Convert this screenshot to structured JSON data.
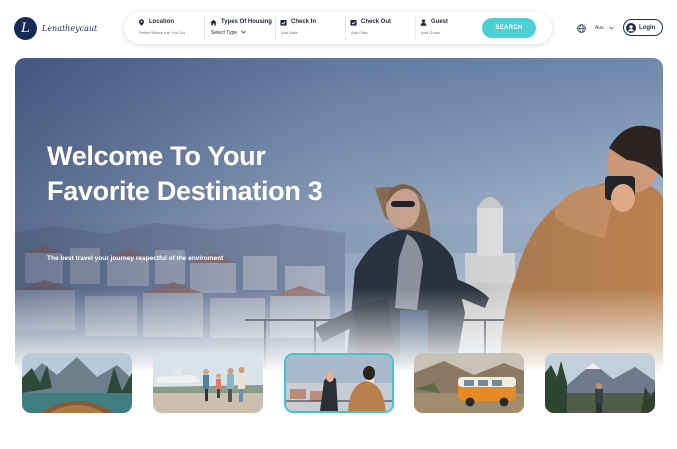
{
  "brand": {
    "name": "Lenatheycaut",
    "initial": "L"
  },
  "search": {
    "location": {
      "label": "Location",
      "placeholder": "Select Where Are You Goi..."
    },
    "housing": {
      "label": "Types Of Housing",
      "value": "Select Type"
    },
    "check_in": {
      "label": "Check In",
      "placeholder": "Add Date"
    },
    "check_out": {
      "label": "Check Out",
      "placeholder": "Add Date"
    },
    "guest": {
      "label": "Guest",
      "placeholder": "Add Guest"
    },
    "button_label": "SEARCH"
  },
  "header": {
    "language": "Aus",
    "login_label": "Login"
  },
  "hero": {
    "title": "Welcome To Your Favorite Destination 3",
    "subtitle": "The best travel your journey respectful of the enviroment"
  },
  "thumbnails": [
    {
      "name": "lake-boat",
      "active": false
    },
    {
      "name": "airfield-travelers",
      "active": false
    },
    {
      "name": "city-photographer",
      "active": true
    },
    {
      "name": "orange-van",
      "active": false
    },
    {
      "name": "mountain-hiker",
      "active": false
    }
  ],
  "colors": {
    "accent": "#4dd0d3",
    "brand_navy": "#172a55",
    "active_border": "#3fc7cc"
  }
}
